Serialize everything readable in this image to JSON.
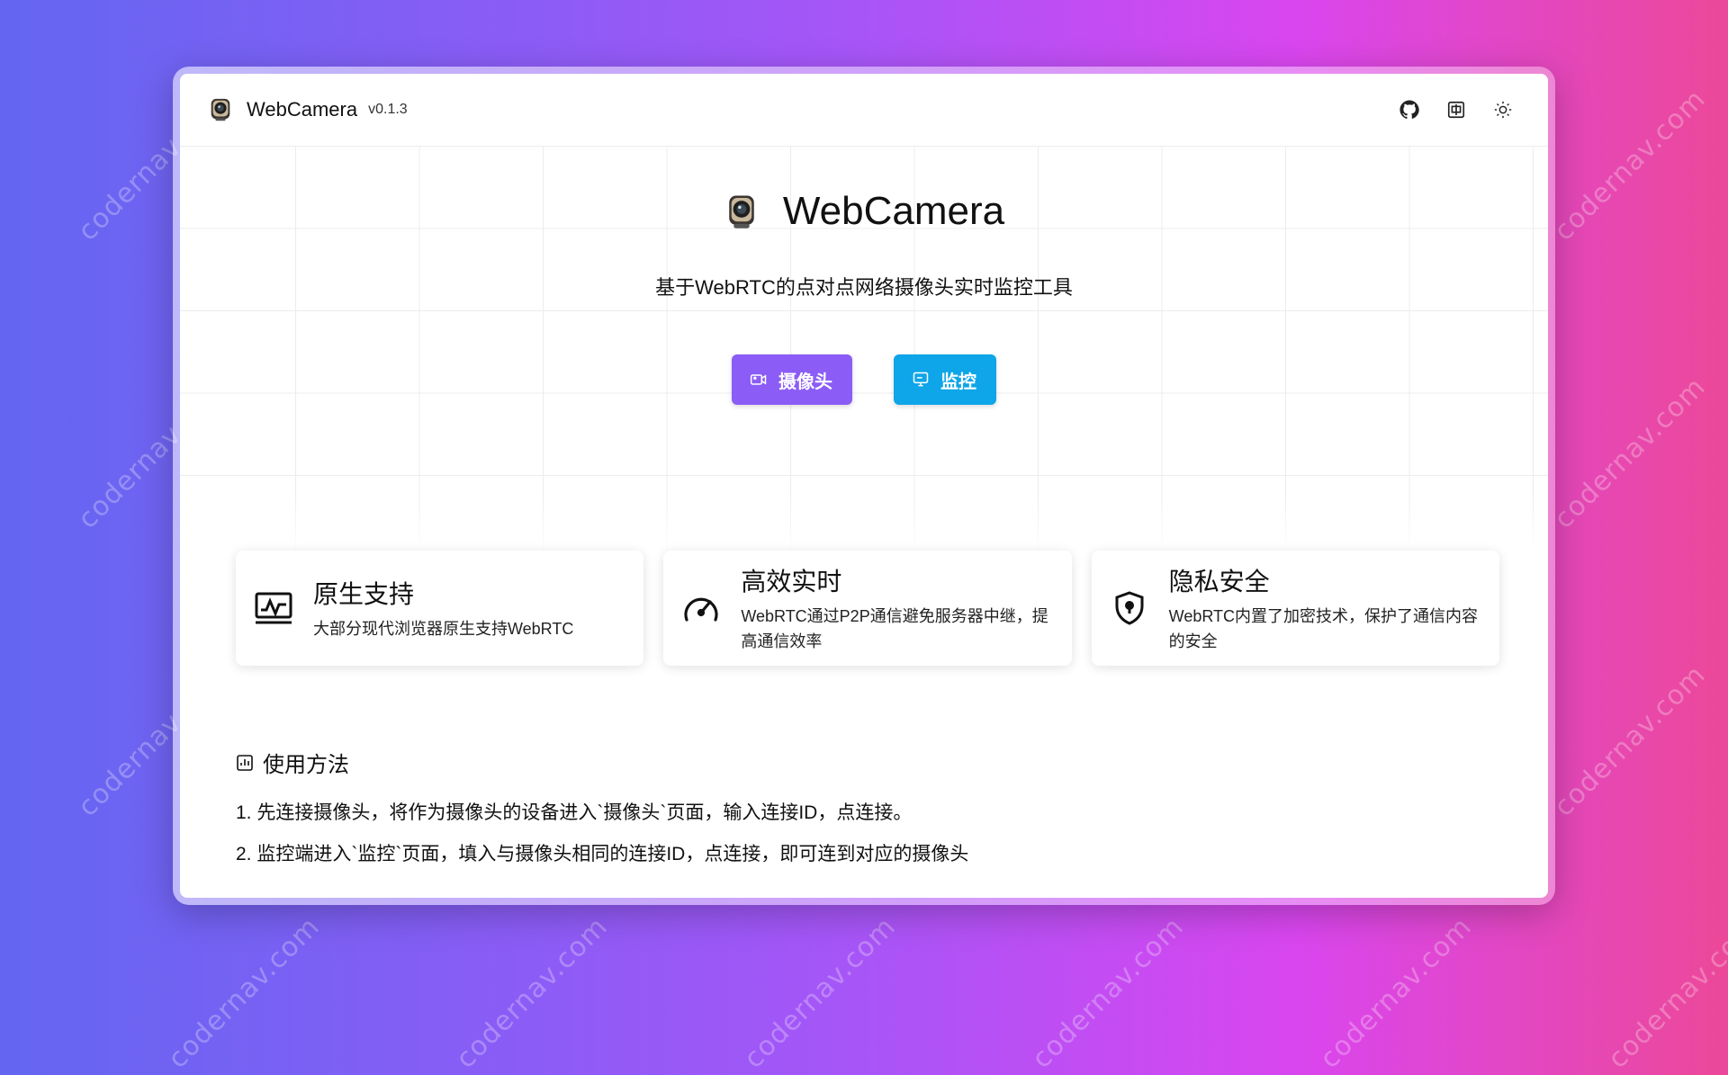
{
  "app": {
    "name": "WebCamera",
    "version": "v0.1.3"
  },
  "header": {
    "actions": [
      {
        "icon": "github-icon"
      },
      {
        "icon": "language-icon",
        "label": "中"
      },
      {
        "icon": "sun-icon"
      }
    ]
  },
  "hero": {
    "title": "WebCamera",
    "subtitle": "基于WebRTC的点对点网络摄像头实时监控工具",
    "camera_button": "摄像头",
    "monitor_button": "监控"
  },
  "features": [
    {
      "icon": "monitor-chart-icon",
      "title": "原生支持",
      "desc": "大部分现代浏览器原生支持WebRTC"
    },
    {
      "icon": "speedometer-icon",
      "title": "高效实时",
      "desc": "WebRTC通过P2P通信避免服务器中继，提高通信效率"
    },
    {
      "icon": "shield-lock-icon",
      "title": "隐私安全",
      "desc": "WebRTC内置了加密技术，保护了通信内容的安全"
    }
  ],
  "usage": {
    "title": "使用方法",
    "steps": [
      "1. 先连接摄像头，将作为摄像头的设备进入`摄像头`页面，输入连接ID，点连接。",
      "2. 监控端进入`监控`页面，填入与摄像头相同的连接ID，点连接，即可连到对应的摄像头"
    ]
  },
  "watermark": "codernav.com",
  "colors": {
    "accent_purple": "#8b5cf6",
    "accent_sky": "#0ea5e9"
  }
}
